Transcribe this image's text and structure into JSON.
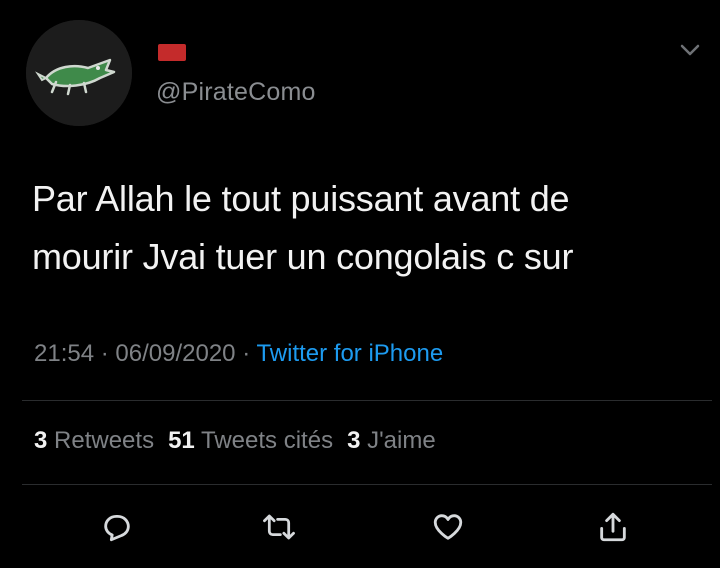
{
  "author": {
    "handle": "@PirateComo"
  },
  "tweet": {
    "line1": "Par Allah le tout puissant avant de",
    "line2": "mourir Jvai tuer un congolais c sur",
    "time": "21:54",
    "date": "06/09/2020",
    "separator": "·",
    "source": "Twitter for iPhone"
  },
  "stats": {
    "retweets_count": "3",
    "retweets_label": "Retweets",
    "quotes_count": "51",
    "quotes_label": "Tweets cités",
    "likes_count": "3",
    "likes_label": "J'aime"
  },
  "actions": {
    "icons": [
      "reply-icon",
      "retweet-icon",
      "like-icon",
      "share-icon"
    ]
  },
  "colors": {
    "background": "#000000",
    "text": "#f2f2f2",
    "secondary": "#7f8286",
    "link": "#1d9bf0",
    "flag": "#c42b2b"
  }
}
